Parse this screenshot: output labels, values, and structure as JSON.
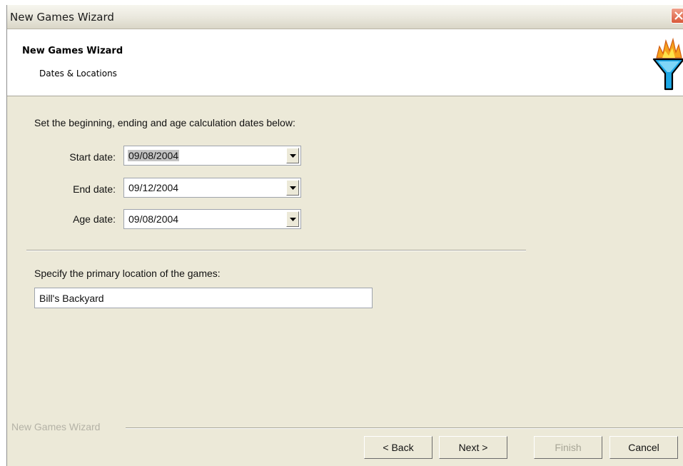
{
  "window": {
    "title": "New Games Wizard"
  },
  "header": {
    "title": "New Games Wizard",
    "subtitle": "Dates & Locations",
    "logo_icon": "funnel-logo-icon"
  },
  "dates_section": {
    "instruction": "Set the beginning, ending and age calculation dates below:",
    "start": {
      "label": "Start date:",
      "value": "09/08/2004"
    },
    "end": {
      "label": "End date:",
      "value": "09/12/2004"
    },
    "age": {
      "label": "Age date:",
      "value": "09/08/2004"
    }
  },
  "location_section": {
    "instruction": "Specify the primary location of the games:",
    "value": "Bill's Backyard"
  },
  "footer": {
    "group_label": "New Games Wizard",
    "back_label": "< Back",
    "next_label": "Next >",
    "finish_label": "Finish",
    "cancel_label": "Cancel"
  },
  "colors": {
    "dialog_bg": "#ece9d8",
    "close_button": "#d9593a",
    "disabled_text": "#a7a596"
  }
}
